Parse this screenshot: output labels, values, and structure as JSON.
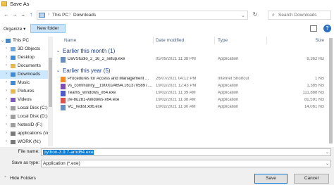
{
  "window": {
    "title": "Save As"
  },
  "address": {
    "crumbs": [
      "This PC",
      "Downloads"
    ]
  },
  "search": {
    "placeholder": "Search Downloads"
  },
  "toolbar": {
    "organize_label": "Organize",
    "new_folder_label": "New folder"
  },
  "sidebar": {
    "items": [
      {
        "label": "This PC",
        "icon": "pc-icon"
      },
      {
        "label": "3D Objects",
        "icon": "cube-icon"
      },
      {
        "label": "Desktop",
        "icon": "desktop-icon"
      },
      {
        "label": "Documents",
        "icon": "document-folder-icon"
      },
      {
        "label": "Downloads",
        "icon": "download-icon"
      },
      {
        "label": "Music",
        "icon": "music-icon"
      },
      {
        "label": "Pictures",
        "icon": "pictures-icon"
      },
      {
        "label": "Videos",
        "icon": "video-icon"
      },
      {
        "label": "Local Disk (C:)",
        "icon": "drive-icon"
      },
      {
        "label": "Local Disk (D:)",
        "icon": "drive-icon"
      },
      {
        "label": "NotesID (F:)",
        "icon": "drive-icon"
      },
      {
        "label": "applications (\\\\r",
        "icon": "network-drive-icon"
      },
      {
        "label": "WORK (N:)",
        "icon": "network-drive-icon"
      }
    ]
  },
  "columns": {
    "name": "Name",
    "date": "Date modified",
    "type": "Type",
    "size": "Size"
  },
  "groups": [
    {
      "label": "Earlier this month (1)",
      "files": [
        {
          "name": "DaVStudio_2_16_2_setup.exe",
          "date": "05/09/2021 11:38 PM",
          "type": "Application",
          "size": "8,362 KB",
          "icon": "exe-icon"
        }
      ]
    },
    {
      "label": "Earlier this year (5)",
      "files": [
        {
          "name": "Procedures for Access and Management ...",
          "date": "26/07/2021 04:12 PM",
          "type": "Internet Shortcut",
          "size": "1 KB",
          "icon": "shortcut-icon"
        },
        {
          "name": "vs_community__1900024694.1613705897....",
          "date": "19/02/2021 12:43 PM",
          "type": "Application",
          "size": "1,385 KB",
          "icon": "visual-studio-icon"
        },
        {
          "name": "Teams_windows_x64.exe",
          "date": "19/02/2021 11:39 AM",
          "type": "Application",
          "size": "111,888 KB",
          "icon": "teams-icon"
        },
        {
          "name": "jre-8u281-windows-x64.exe",
          "date": "19/02/2021 11:38 AM",
          "type": "Application",
          "size": "81,591 KB",
          "icon": "java-icon"
        },
        {
          "name": "VC_redist.x86.exe",
          "date": "19/02/2021 11:30 AM",
          "type": "Application",
          "size": "14,061 KB",
          "icon": "exe-icon"
        }
      ]
    }
  ],
  "save": {
    "filename_label": "File name:",
    "filename_value": "python-3.9.7-amd64.exe",
    "type_label": "Save as type:",
    "type_value": "Application (*.exe)"
  },
  "bottom": {
    "hide_folders_label": "Hide Folders",
    "save_label": "Save",
    "cancel_label": "Cancel"
  },
  "colors": {
    "accent": "#0078d7",
    "selected_bg": "#cce8ff",
    "group_header": "#1e3f8a"
  }
}
